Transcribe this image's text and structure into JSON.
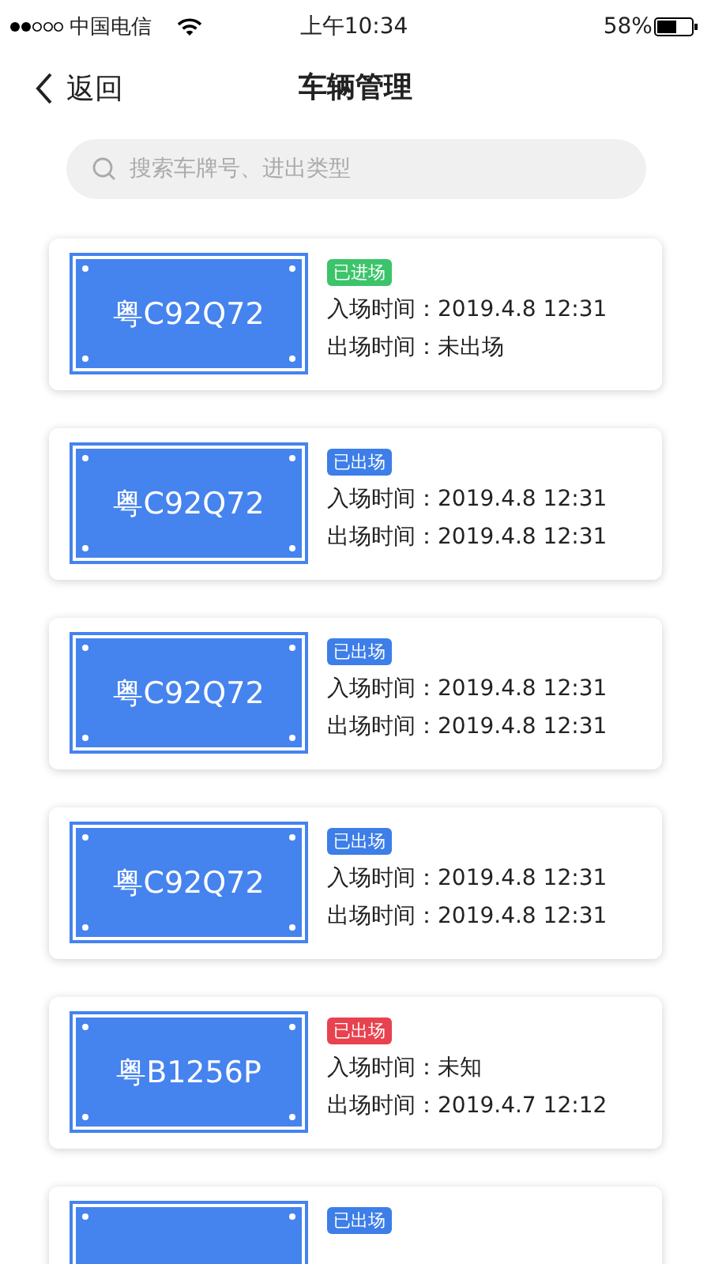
{
  "status_bar": {
    "carrier": "中国电信",
    "time": "上午10:34",
    "battery": "58%"
  },
  "nav": {
    "back": "返回",
    "title": "车辆管理"
  },
  "search": {
    "placeholder": "搜索车牌号、进出类型"
  },
  "vehicles": [
    {
      "plate": "粤C92Q72",
      "status": "已进场",
      "kind": "in",
      "entry_label": "入场时间：",
      "entry": "2019.4.8 12:31",
      "exit_label": "出场时间：",
      "exit": "未出场"
    },
    {
      "plate": "粤C92Q72",
      "status": "已出场",
      "kind": "out",
      "entry_label": "入场时间：",
      "entry": "2019.4.8 12:31",
      "exit_label": "出场时间：",
      "exit": "2019.4.8 12:31"
    },
    {
      "plate": "粤C92Q72",
      "status": "已出场",
      "kind": "out",
      "entry_label": "入场时间：",
      "entry": "2019.4.8 12:31",
      "exit_label": "出场时间：",
      "exit": "2019.4.8 12:31"
    },
    {
      "plate": "粤C92Q72",
      "status": "已出场",
      "kind": "out",
      "entry_label": "入场时间：",
      "entry": "2019.4.8 12:31",
      "exit_label": "出场时间：",
      "exit": "2019.4.8 12:31"
    },
    {
      "plate": "粤B1256P",
      "status": "已出场",
      "kind": "unknown",
      "entry_label": "入场时间：",
      "entry": "未知",
      "exit_label": "出场时间：",
      "exit": "2019.4.7 12:12"
    },
    {
      "status": "已出场",
      "kind": "out"
    }
  ]
}
